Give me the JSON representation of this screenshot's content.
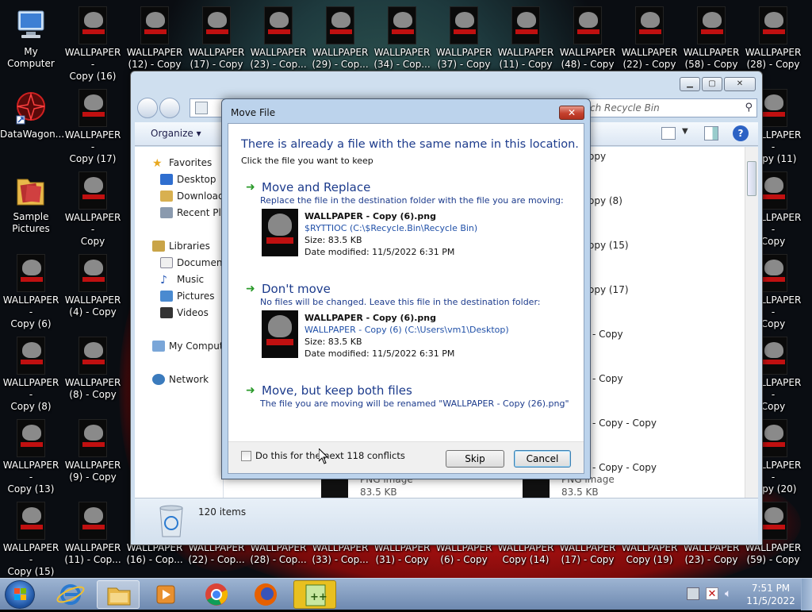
{
  "desktop": {
    "icons": [
      {
        "label": "My Computer",
        "x": 40
      },
      {
        "label": "WALLPAPER -\nCopy (16)"
      },
      {
        "label": "WALLPAPER\n(12) - Copy"
      },
      {
        "label": "WALLPAPER\n(17) - Copy"
      },
      {
        "label": "WALLPAPER\n(23) - Cop..."
      },
      {
        "label": "WALLPAPER\n(29) - Cop..."
      },
      {
        "label": "WALLPAPER\n(34) - Cop..."
      },
      {
        "label": "WALLPAPER\n(37) - Copy"
      },
      {
        "label": "WALLPAPER\n(11) - Copy"
      },
      {
        "label": "WALLPAPER\n(48) - Copy"
      },
      {
        "label": "WALLPAPER\n(22) - Copy"
      },
      {
        "label": "WALLPAPER\n(58) - Copy"
      },
      {
        "label": "WALLPAPER\n(28) - Copy"
      }
    ],
    "left_col": [
      {
        "label": "DataWagon..."
      },
      {
        "label": "Sample\nPictures"
      },
      {
        "label": "WALLPAPER -\nCopy (6)"
      },
      {
        "label": "WALLPAPER -\nCopy (8)"
      },
      {
        "label": "WALLPAPER -\nCopy (13)"
      },
      {
        "label": "WALLPAPER -\nCopy (15)"
      }
    ],
    "col2": [
      {
        "label": "WALLPAPER -\nCopy (17)"
      },
      {
        "label": "WALLPAPER -\nCopy"
      },
      {
        "label": "WALLPAPER\n(4) - Copy"
      },
      {
        "label": "WALLPAPER\n(8) - Copy"
      },
      {
        "label": "WALLPAPER\n(9) - Copy"
      },
      {
        "label": "WALLPAPER\n(11) - Cop..."
      }
    ],
    "right_col": [
      {
        "label": "WALLPAPER -\nCopy (11)"
      },
      {
        "label": "WALLPAPER -\nCopy"
      },
      {
        "label": "WALLPAPER -\nCopy"
      },
      {
        "label": "WALLPAPER -\nCopy"
      },
      {
        "label": "WALLPAPER -\nCopy (20)"
      },
      {
        "label": "WALLPAPER\n(59) - Copy"
      }
    ],
    "bottom_row": [
      {
        "label": "WALLPAPER\n(16) - Cop..."
      },
      {
        "label": "WALLPAPER\n(22) - Cop..."
      },
      {
        "label": "WALLPAPER\n(28) - Cop..."
      },
      {
        "label": "WALLPAPER\n(33) - Cop..."
      },
      {
        "label": "WALLPAPER\n(31) - Copy"
      },
      {
        "label": "WALLPAPER\n(6) - Copy"
      },
      {
        "label": "WALLPAPER\nCopy (14)"
      },
      {
        "label": "WALLPAPER\n(17) - Copy"
      },
      {
        "label": "WALLPAPER\nCopy (19)"
      },
      {
        "label": "WALLPAPER\n(23) - Copy"
      }
    ]
  },
  "explorer": {
    "search_placeholder": "ch Recycle Bin",
    "organize_label": "Organize",
    "nav": {
      "favorites": "Favorites",
      "desktop": "Desktop",
      "downloads": "Downloads",
      "recent": "Recent Plac",
      "libraries": "Libraries",
      "documents": "Document",
      "music": "Music",
      "pictures": "Pictures",
      "videos": "Videos",
      "computer": "My Compute",
      "network": "Network"
    },
    "file_fragments": [
      "opy",
      "opy (8)",
      "opy (15)",
      "opy (17)",
      "- Copy",
      "- Copy",
      "- Copy - Copy",
      "- Copy - Copy"
    ],
    "bottom_files": [
      {
        "type": "PNG image",
        "size": "83.5 KB"
      },
      {
        "type": "PNG image",
        "size": "83.5 KB"
      }
    ],
    "status_count": "120 items"
  },
  "dialog": {
    "title": "Move File",
    "close_glyph": "✕",
    "heading": "There is already a file with the same name in this location.",
    "subheading": "Click the file you want to keep",
    "options": {
      "replace": {
        "title": "Move and Replace",
        "desc": "Replace the file in the destination folder with the file you are moving:",
        "file_name": "WALLPAPER - Copy (6).png",
        "file_path": "$RYTTIOC (C:\\$Recycle.Bin\\Recycle Bin)",
        "file_size": "Size: 83.5 KB",
        "file_date": "Date modified: 11/5/2022 6:31 PM"
      },
      "dont_move": {
        "title": "Don't move",
        "desc": "No files will be changed. Leave this file in the destination folder:",
        "file_name": "WALLPAPER - Copy (6).png",
        "file_path": "WALLPAPER - Copy (6) (C:\\Users\\vm1\\Desktop)",
        "file_size": "Size: 83.5 KB",
        "file_date": "Date modified: 11/5/2022 6:31 PM"
      },
      "keep_both": {
        "title": "Move, but keep both files",
        "desc": "The file you are moving will be renamed \"WALLPAPER - Copy (26).png\""
      }
    },
    "checkbox_label": "Do this for the next 118 conflicts",
    "skip_label": "Skip",
    "cancel_label": "Cancel"
  },
  "taskbar": {
    "time": "7:51 PM",
    "date": "11/5/2022"
  }
}
